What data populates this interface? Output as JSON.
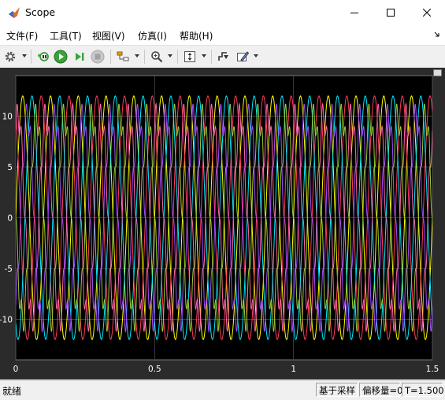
{
  "window": {
    "title": "Scope"
  },
  "menu": [
    "文件(F)",
    "工具(T)",
    "视图(V)",
    "仿真(I)",
    "帮助(H)"
  ],
  "toolbar_icons": [
    "gear-icon",
    "restore-icon",
    "run-icon",
    "step-forward-icon",
    "stop-icon",
    "layout-icon",
    "zoom-icon",
    "autoscale-icon",
    "triggers-icon",
    "style-icon"
  ],
  "plot": {
    "y_ticks": [
      "10",
      "5",
      "0",
      "-5",
      "-10"
    ],
    "x_ticks": [
      "0",
      "0.5",
      "1",
      "1.5"
    ],
    "background": "#000000",
    "grid_color": "#4a4a4a",
    "axis_text_color": "#ffffff"
  },
  "chart_data": {
    "type": "line",
    "xlim": [
      0,
      1.5
    ],
    "ylim": [
      -14,
      14
    ],
    "grid": true,
    "waveform": "sinusoidal, six-phase",
    "frequency_hz": 10,
    "series": [
      {
        "color": "#ffff00",
        "amplitude": 12,
        "phase_deg": 0,
        "shape": "sine"
      },
      {
        "color": "#ff3b5c",
        "amplitude": 12,
        "phase_deg": 120,
        "shape": "sine"
      },
      {
        "color": "#00e8ff",
        "amplitude": 12,
        "phase_deg": 240,
        "shape": "sine"
      },
      {
        "color": "#ff66aa",
        "amplitude": 10,
        "phase_deg": 60,
        "shape": "sine-with-ripple"
      },
      {
        "color": "#9acd32",
        "amplitude": 10,
        "phase_deg": 180,
        "shape": "sine-with-ripple"
      },
      {
        "color": "#a64dff",
        "amplitude": 10,
        "phase_deg": 300,
        "shape": "sine-with-ripple"
      }
    ]
  },
  "status": {
    "left": "就绪",
    "sample_mode": "基于采样",
    "offset": "偏移量=0",
    "time": "T=1.500"
  }
}
